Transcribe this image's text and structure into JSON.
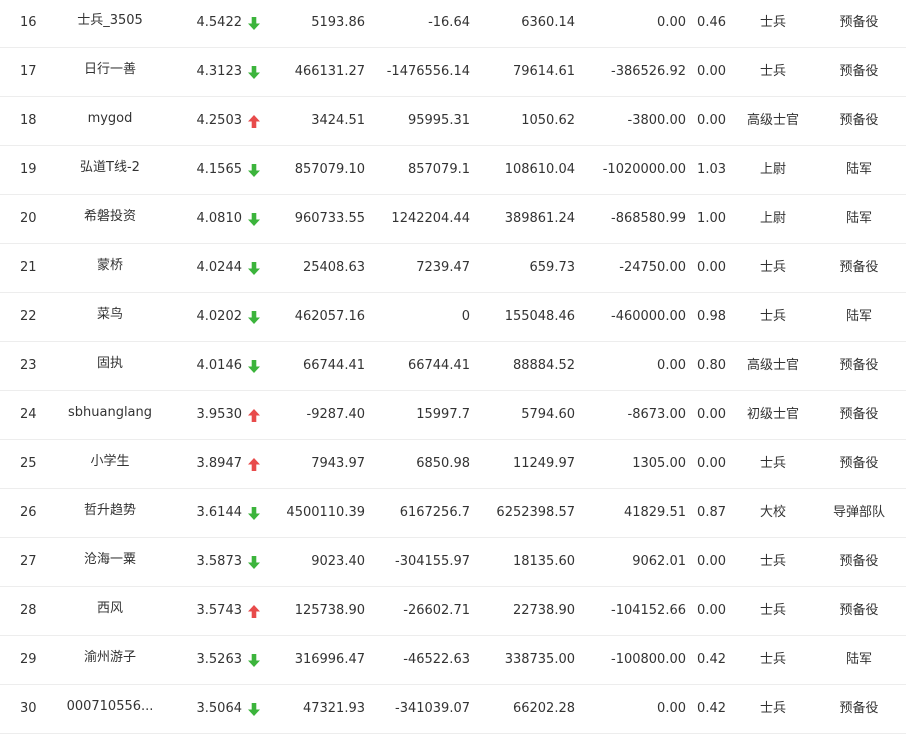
{
  "colors": {
    "down_arrow": "#3cb43c",
    "up_arrow": "#e84b4b",
    "row_divider": "#ededed",
    "text": "#333333"
  },
  "rows": [
    {
      "rank": "16",
      "name": "士兵_3505",
      "score": "4.5422",
      "trend": "down",
      "v1": "5193.86",
      "v2": "-16.64",
      "v3": "6360.14",
      "v4": "0.00",
      "v5": "0.46",
      "rank_name": "士兵",
      "unit": "预备役"
    },
    {
      "rank": "17",
      "name": "日行一善",
      "score": "4.3123",
      "trend": "down",
      "v1": "466131.27",
      "v2": "-1476556.14",
      "v3": "79614.61",
      "v4": "-386526.92",
      "v5": "0.00",
      "rank_name": "士兵",
      "unit": "预备役"
    },
    {
      "rank": "18",
      "name": "mygod",
      "score": "4.2503",
      "trend": "up",
      "v1": "3424.51",
      "v2": "95995.31",
      "v3": "1050.62",
      "v4": "-3800.00",
      "v5": "0.00",
      "rank_name": "高级士官",
      "unit": "预备役"
    },
    {
      "rank": "19",
      "name": "弘道T线-2",
      "score": "4.1565",
      "trend": "down",
      "v1": "857079.10",
      "v2": "857079.1",
      "v3": "108610.04",
      "v4": "-1020000.00",
      "v5": "1.03",
      "rank_name": "上尉",
      "unit": "陆军"
    },
    {
      "rank": "20",
      "name": "希磐投资",
      "score": "4.0810",
      "trend": "down",
      "v1": "960733.55",
      "v2": "1242204.44",
      "v3": "389861.24",
      "v4": "-868580.99",
      "v5": "1.00",
      "rank_name": "上尉",
      "unit": "陆军"
    },
    {
      "rank": "21",
      "name": "蒙桥",
      "score": "4.0244",
      "trend": "down",
      "v1": "25408.63",
      "v2": "7239.47",
      "v3": "659.73",
      "v4": "-24750.00",
      "v5": "0.00",
      "rank_name": "士兵",
      "unit": "预备役"
    },
    {
      "rank": "22",
      "name": "菜鸟",
      "score": "4.0202",
      "trend": "down",
      "v1": "462057.16",
      "v2": "0",
      "v3": "155048.46",
      "v4": "-460000.00",
      "v5": "0.98",
      "rank_name": "士兵",
      "unit": "陆军"
    },
    {
      "rank": "23",
      "name": "固执",
      "score": "4.0146",
      "trend": "down",
      "v1": "66744.41",
      "v2": "66744.41",
      "v3": "88884.52",
      "v4": "0.00",
      "v5": "0.80",
      "rank_name": "高级士官",
      "unit": "预备役"
    },
    {
      "rank": "24",
      "name": "sbhuanglang",
      "score": "3.9530",
      "trend": "up",
      "v1": "-9287.40",
      "v2": "15997.7",
      "v3": "5794.60",
      "v4": "-8673.00",
      "v5": "0.00",
      "rank_name": "初级士官",
      "unit": "预备役"
    },
    {
      "rank": "25",
      "name": "小学生",
      "score": "3.8947",
      "trend": "up",
      "v1": "7943.97",
      "v2": "6850.98",
      "v3": "11249.97",
      "v4": "1305.00",
      "v5": "0.00",
      "rank_name": "士兵",
      "unit": "预备役"
    },
    {
      "rank": "26",
      "name": "哲升趋势",
      "score": "3.6144",
      "trend": "down",
      "v1": "4500110.39",
      "v2": "6167256.7",
      "v3": "6252398.57",
      "v4": "41829.51",
      "v5": "0.87",
      "rank_name": "大校",
      "unit": "导弹部队"
    },
    {
      "rank": "27",
      "name": "沧海一粟",
      "score": "3.5873",
      "trend": "down",
      "v1": "9023.40",
      "v2": "-304155.97",
      "v3": "18135.60",
      "v4": "9062.01",
      "v5": "0.00",
      "rank_name": "士兵",
      "unit": "预备役"
    },
    {
      "rank": "28",
      "name": "西风",
      "score": "3.5743",
      "trend": "up",
      "v1": "125738.90",
      "v2": "-26602.71",
      "v3": "22738.90",
      "v4": "-104152.66",
      "v5": "0.00",
      "rank_name": "士兵",
      "unit": "预备役"
    },
    {
      "rank": "29",
      "name": "渝州游子",
      "score": "3.5263",
      "trend": "down",
      "v1": "316996.47",
      "v2": "-46522.63",
      "v3": "338735.00",
      "v4": "-100800.00",
      "v5": "0.42",
      "rank_name": "士兵",
      "unit": "陆军"
    },
    {
      "rank": "30",
      "name": "000710556...",
      "score": "3.5064",
      "trend": "down",
      "v1": "47321.93",
      "v2": "-341039.07",
      "v3": "66202.28",
      "v4": "0.00",
      "v5": "0.42",
      "rank_name": "士兵",
      "unit": "预备役"
    }
  ]
}
